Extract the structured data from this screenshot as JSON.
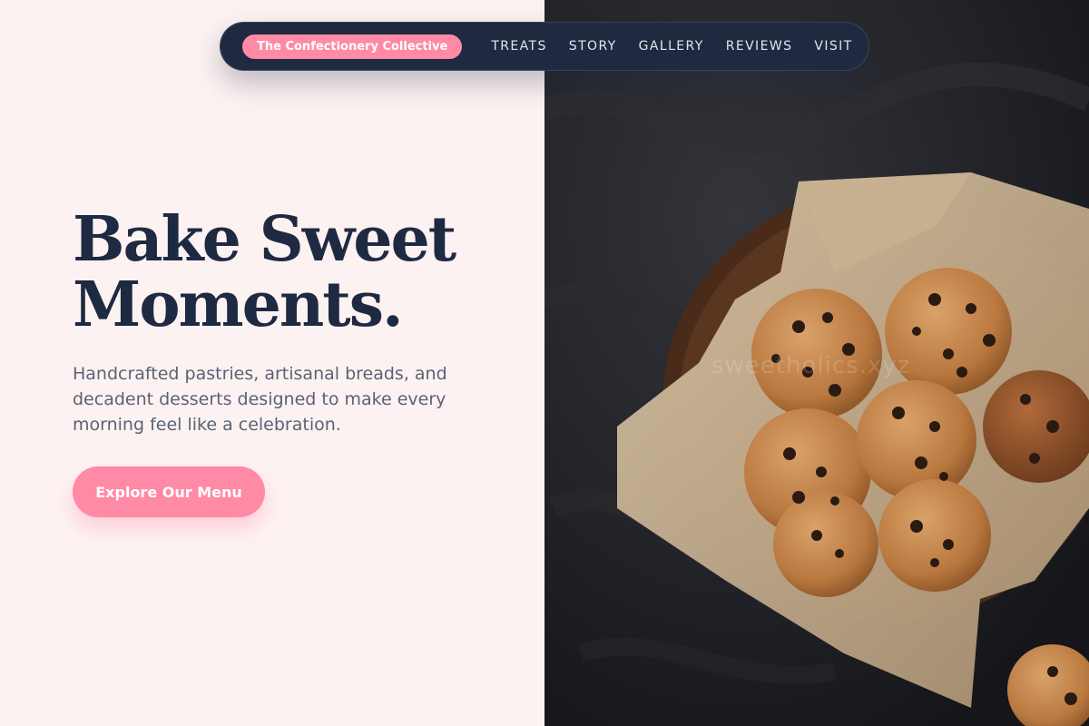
{
  "nav": {
    "brand": "The Confectionery Collective",
    "links": [
      "TREATS",
      "STORY",
      "GALLERY",
      "REVIEWS",
      "VISIT"
    ]
  },
  "hero": {
    "title_line1": "Bake Sweet",
    "title_line2": "Moments.",
    "subtitle": "Handcrafted pastries, artisanal breads, and decadent desserts designed to make every morning feel like a celebration.",
    "cta_label": "Explore Our Menu"
  },
  "photo": {
    "subject": "bowl of chocolate chip cookies on parchment paper",
    "watermark": "sweetholics.xyz"
  },
  "colors": {
    "accent": "#ff8aa6",
    "navy": "#1e2a42",
    "background": "#fdf2f2",
    "body_text": "#5a6275"
  }
}
